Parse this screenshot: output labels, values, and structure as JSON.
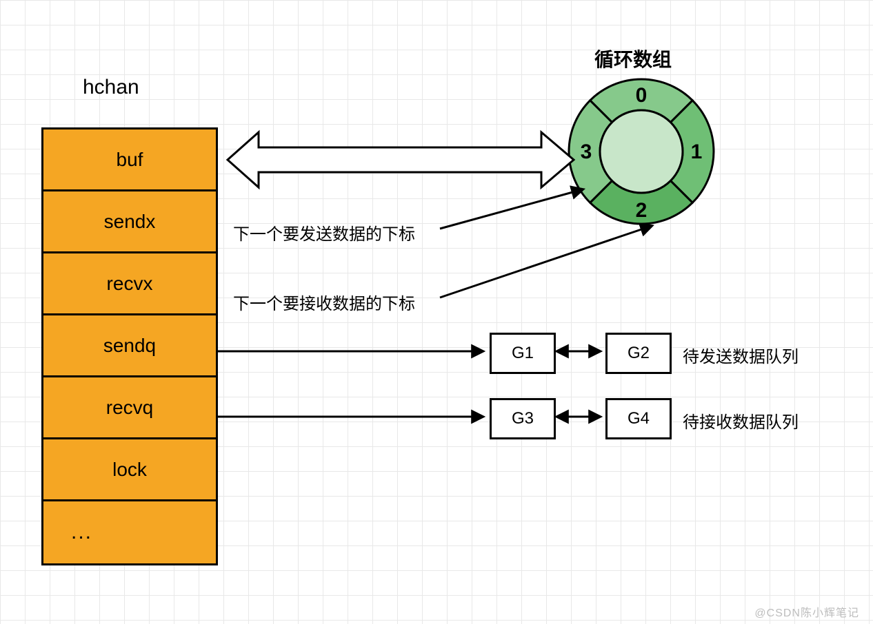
{
  "struct": {
    "title": "hchan",
    "fields": [
      "buf",
      "sendx",
      "recvx",
      "sendq",
      "recvq",
      "lock",
      "..."
    ]
  },
  "ring": {
    "title": "循环数组",
    "slots": [
      "0",
      "1",
      "2",
      "3"
    ]
  },
  "notes": {
    "sendx": "下一个要发送数据的下标",
    "recvx": "下一个要接收数据的下标"
  },
  "queues": {
    "sendq": {
      "nodes": [
        "G1",
        "G2"
      ],
      "label": "待发送数据队列"
    },
    "recvq": {
      "nodes": [
        "G3",
        "G4"
      ],
      "label": "待接收数据队列"
    }
  },
  "watermark": "@CSDN陈小辉笔记"
}
